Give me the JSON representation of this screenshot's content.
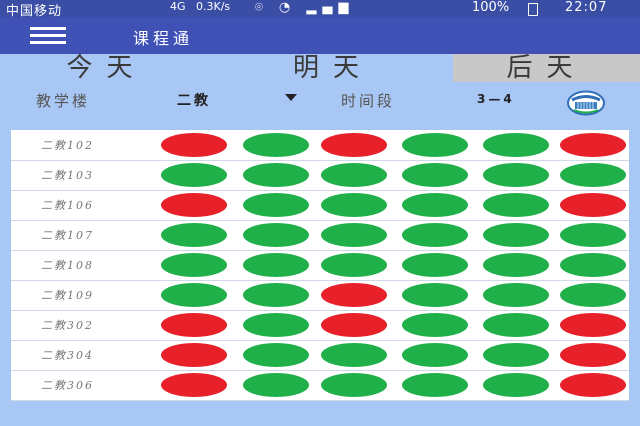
{
  "status_bar": {
    "carrier": "中国移动",
    "network": "4G",
    "speed": "0.3K/s",
    "battery": "100%",
    "time": "22:07"
  },
  "app_bar": {
    "title": "课程通",
    "menu_icon": "hamburger-menu-icon"
  },
  "day_tabs": [
    {
      "label": "今天",
      "active": true
    },
    {
      "label": "明天",
      "active": true
    },
    {
      "label": "后天",
      "active": false
    }
  ],
  "filters": {
    "building_label": "教学楼",
    "building_value": "二教",
    "period_label": "时间段",
    "period_value": "3—4",
    "query_icon": "globe-icon"
  },
  "colors": {
    "occupied": "#e8202a",
    "free": "#20b04a"
  },
  "rooms": [
    {
      "name": "二教102",
      "slots": [
        "occupied",
        "free",
        "occupied",
        "free",
        "free",
        "occupied"
      ]
    },
    {
      "name": "二教103",
      "slots": [
        "free",
        "free",
        "free",
        "free",
        "free",
        "free"
      ]
    },
    {
      "name": "二教106",
      "slots": [
        "occupied",
        "free",
        "free",
        "free",
        "free",
        "occupied"
      ]
    },
    {
      "name": "二教107",
      "slots": [
        "free",
        "free",
        "free",
        "free",
        "free",
        "free"
      ]
    },
    {
      "name": "二教108",
      "slots": [
        "free",
        "free",
        "free",
        "free",
        "free",
        "free"
      ]
    },
    {
      "name": "二教109",
      "slots": [
        "free",
        "free",
        "occupied",
        "free",
        "free",
        "free"
      ]
    },
    {
      "name": "二教302",
      "slots": [
        "occupied",
        "free",
        "occupied",
        "free",
        "free",
        "occupied"
      ]
    },
    {
      "name": "二教304",
      "slots": [
        "occupied",
        "free",
        "free",
        "free",
        "free",
        "occupied"
      ]
    },
    {
      "name": "二教306",
      "slots": [
        "occupied",
        "free",
        "free",
        "free",
        "free",
        "occupied"
      ]
    }
  ]
}
